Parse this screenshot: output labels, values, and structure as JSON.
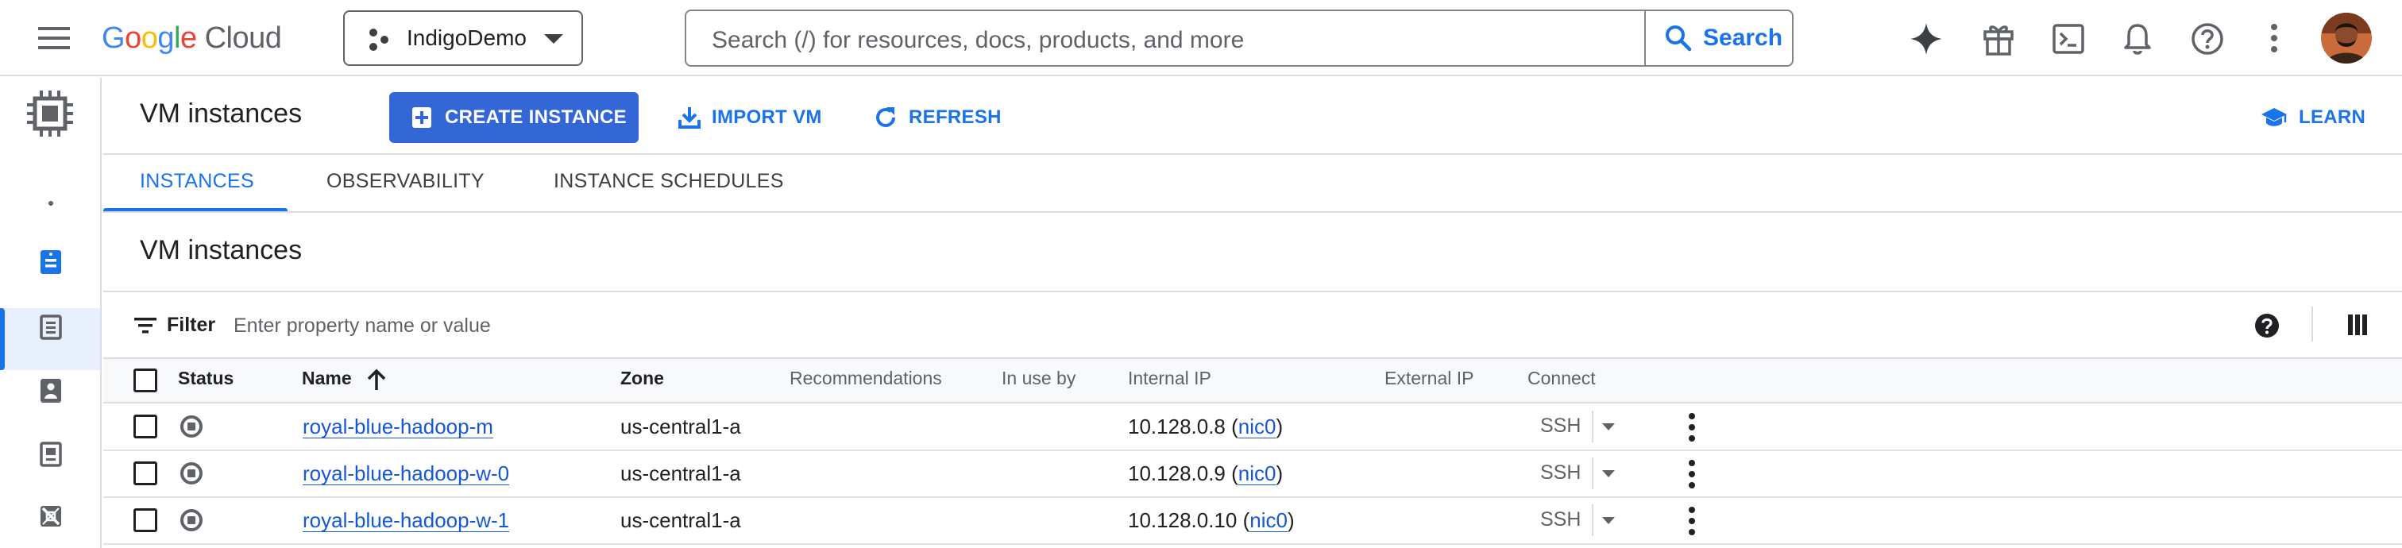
{
  "topbar": {
    "logo_google": "Google",
    "logo_cloud": "Cloud",
    "project_name": "IndigoDemo",
    "search_placeholder": "Search (/) for resources, docs, products, and more",
    "search_button": "Search"
  },
  "page": {
    "title": "VM instances",
    "create_button": "CREATE INSTANCE",
    "import_button": "IMPORT VM",
    "refresh_button": "REFRESH",
    "learn_button": "LEARN"
  },
  "tabs": [
    {
      "label": "INSTANCES",
      "active": true
    },
    {
      "label": "OBSERVABILITY",
      "active": false
    },
    {
      "label": "INSTANCE SCHEDULES",
      "active": false
    }
  ],
  "section_title": "VM instances",
  "filter": {
    "label": "Filter",
    "placeholder": "Enter property name or value"
  },
  "table": {
    "columns": [
      "Status",
      "Name",
      "Zone",
      "Recommendations",
      "In use by",
      "Internal IP",
      "External IP",
      "Connect"
    ],
    "sort_column": "Name",
    "rows": [
      {
        "name": "royal-blue-hadoop-m",
        "zone": "us-central1-a",
        "ip": "10.128.0.8",
        "nic": "nic0",
        "connect": "SSH",
        "status": "stopped"
      },
      {
        "name": "royal-blue-hadoop-w-0",
        "zone": "us-central1-a",
        "ip": "10.128.0.9",
        "nic": "nic0",
        "connect": "SSH",
        "status": "stopped"
      },
      {
        "name": "royal-blue-hadoop-w-1",
        "zone": "us-central1-a",
        "ip": "10.128.0.10",
        "nic": "nic0",
        "connect": "SSH",
        "status": "stopped"
      }
    ]
  },
  "colors": {
    "accent": "#1a73e8",
    "primary_button": "#3367d6",
    "google_blue": "#4285F4",
    "google_red": "#EA4335",
    "google_yellow": "#FBBC05",
    "google_green": "#34A853"
  }
}
